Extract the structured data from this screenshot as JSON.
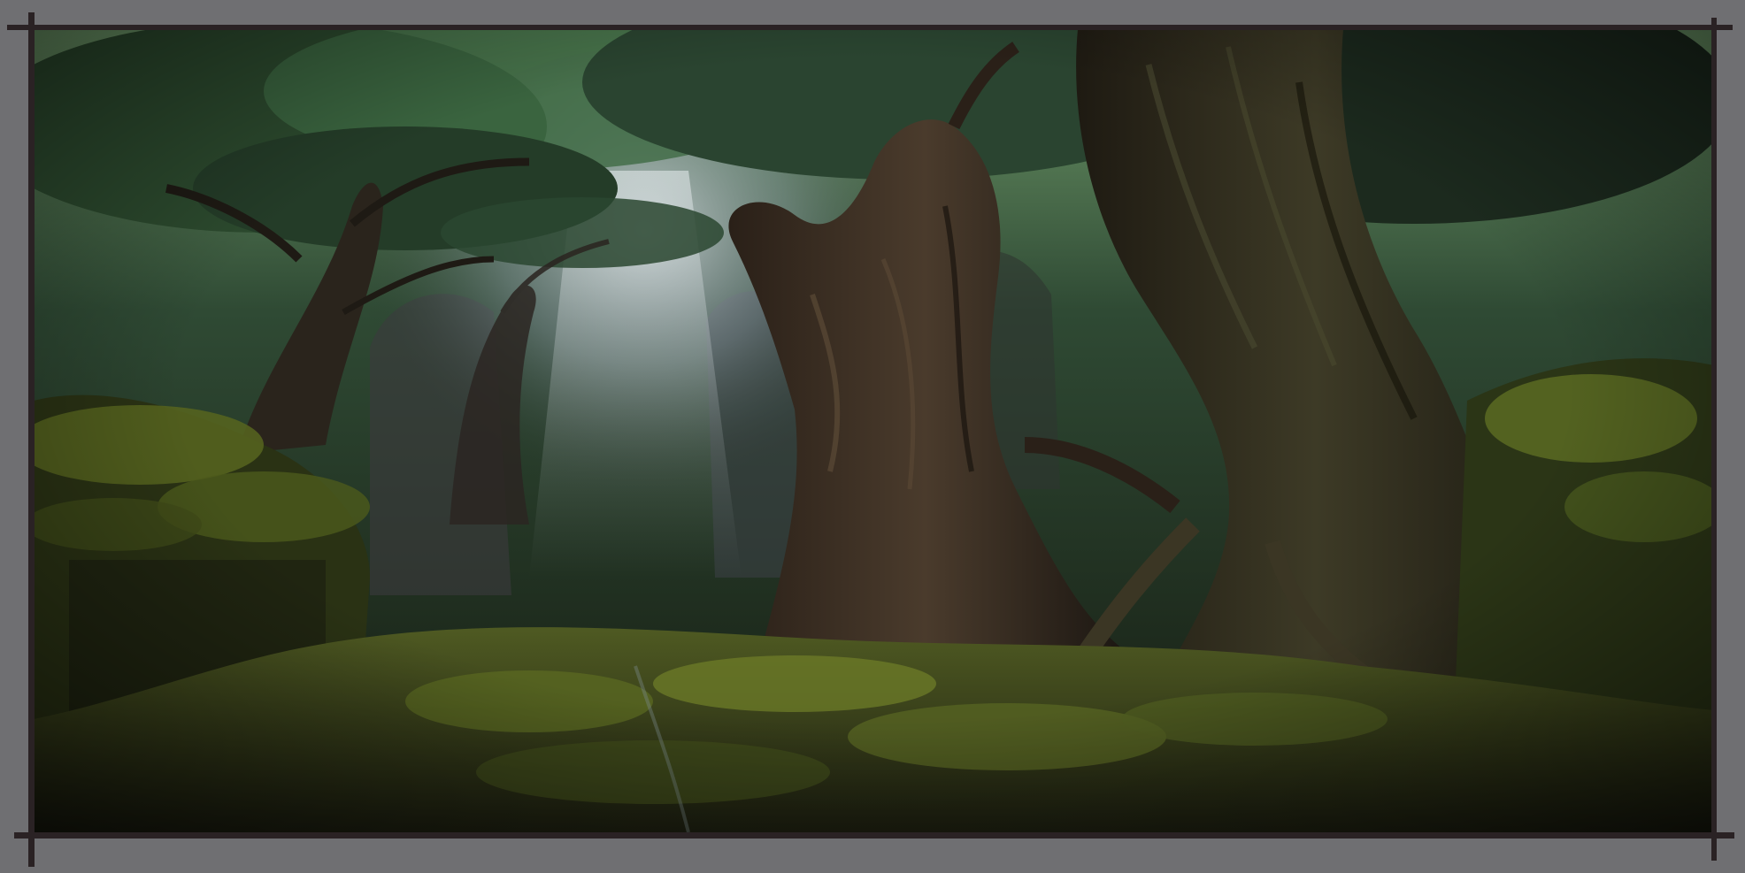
{
  "artwork": {
    "subject": "forest-painting",
    "palette": {
      "mat": "#6f6f72",
      "frame": "#2a2224",
      "canopy": "#3f6a3c",
      "moss": "#5c6b22",
      "trunk": "#3b2e22",
      "shadow": "#12140e",
      "light": "#cfd6dc"
    }
  }
}
